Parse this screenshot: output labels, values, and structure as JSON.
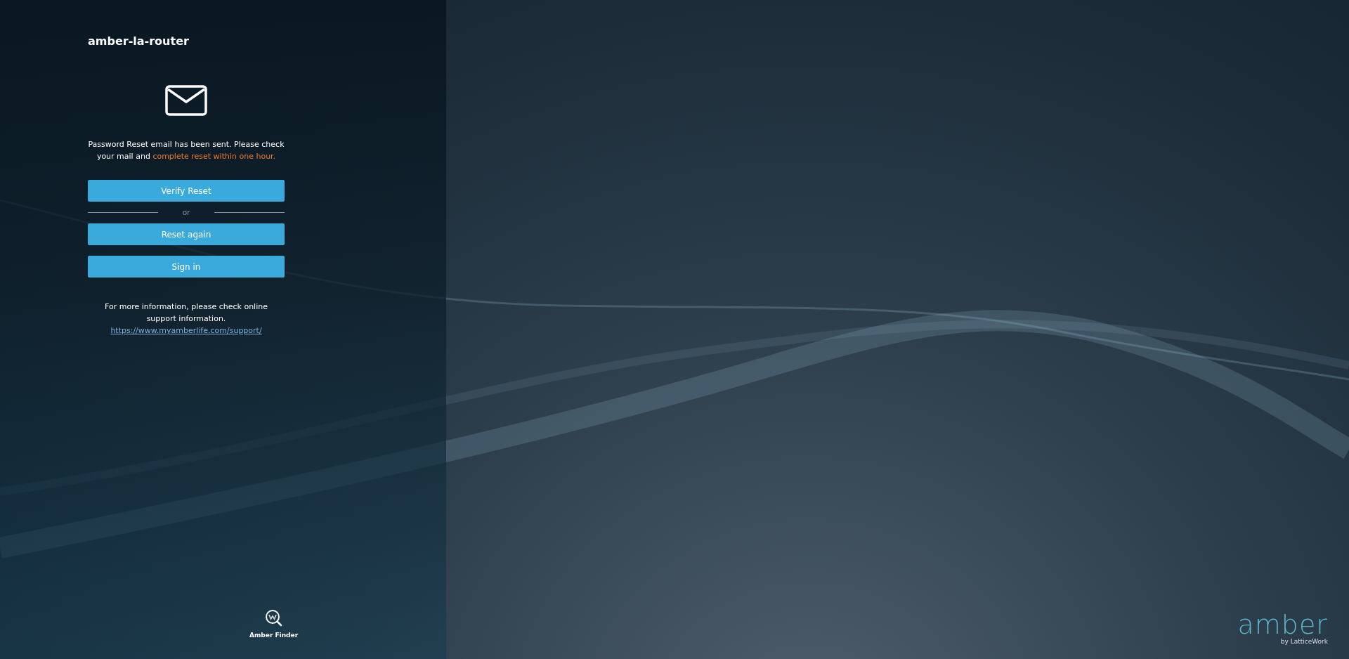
{
  "device_name": "amber-la-router",
  "message": {
    "text": "Password Reset email has been sent. Please check your mail and",
    "highlight": "complete reset within one hour."
  },
  "buttons": [
    {
      "kind": "primary",
      "label": "Verify Reset"
    },
    {
      "kind": "separator",
      "label": "or"
    },
    {
      "kind": "primary",
      "label": "Reset again"
    },
    {
      "kind": "primary",
      "label": "Sign in"
    }
  ],
  "support": {
    "text": "For more information, please check online support information.",
    "link": "https://www.myamberlife.com/support/"
  },
  "finder": {
    "label": "Amber Finder"
  },
  "brand": {
    "logo": "amber",
    "byline": "by LatticeWork"
  }
}
